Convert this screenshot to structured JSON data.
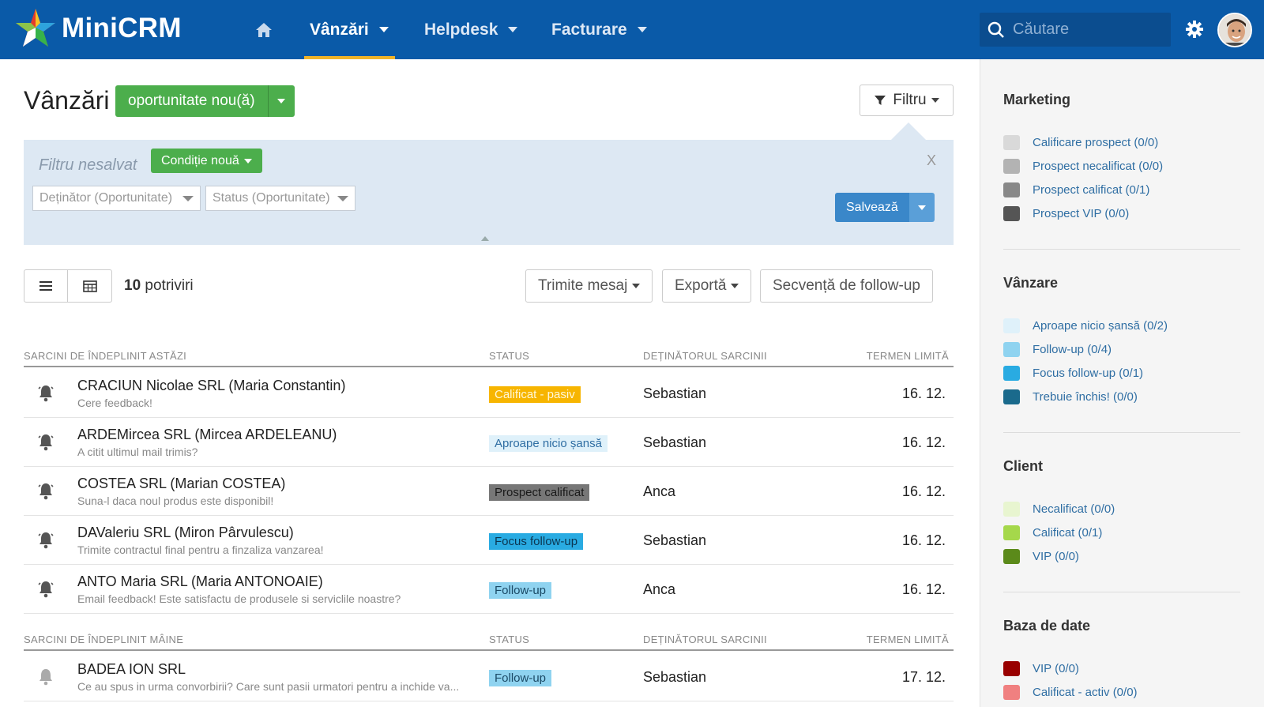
{
  "app": {
    "name": "MiniCRM"
  },
  "nav": {
    "items": [
      {
        "label": "Vânzări"
      },
      {
        "label": "Helpdesk"
      },
      {
        "label": "Facturare"
      }
    ],
    "search_placeholder": "Căutare"
  },
  "page": {
    "title": "Vânzări",
    "new_button": "oportunitate nou(ă)",
    "filter_button": "Filtru"
  },
  "filter": {
    "unsaved_label": "Filtru nesalvat",
    "new_condition": "Condiție nouă",
    "close": "X",
    "owner_select": "Deținător (Oportunitate)",
    "status_select": "Status (Oportunitate)",
    "save_button": "Salvează"
  },
  "toolbar": {
    "count": "10",
    "count_label": "potriviri",
    "send_message": "Trimite mesaj",
    "export": "Exportă",
    "followup_sequence": "Secvență de follow-up"
  },
  "columns": {
    "status": "STATUS",
    "owner": "DEȚINĂTORUL SARCINII",
    "due": "TERMEN LIMITĂ"
  },
  "today": {
    "heading": "SARCINI DE ÎNDEPLINIT ASTĂZI",
    "rows": [
      {
        "title": "CRACIUN Nicolae SRL (Maria Constantin)",
        "subtitle": "Cere feedback!",
        "status": "Calificat - pasiv",
        "owner": "Sebastian",
        "due": "16. 12."
      },
      {
        "title": "ARDEMircea SRL (Mircea ARDELEANU)",
        "subtitle": "A citit ultimul mail trimis?",
        "status": "Aproape nicio șansă",
        "owner": "Sebastian",
        "due": "16. 12."
      },
      {
        "title": "COSTEA SRL (Marian COSTEA)",
        "subtitle": "Suna-l daca noul produs este disponibil!",
        "status": "Prospect calificat",
        "owner": "Anca",
        "due": "16. 12."
      },
      {
        "title": "DAValeriu SRL (Miron Pârvulescu)",
        "subtitle": "Trimite contractul final pentru a finzaliza vanzarea!",
        "status": "Focus follow-up",
        "owner": "Sebastian",
        "due": "16. 12."
      },
      {
        "title": "ANTO Maria SRL (Maria ANTONOAIE)",
        "subtitle": "Email feedback! Este satisfactu de produsele si serviclile noastre?",
        "status": "Follow-up",
        "owner": "Anca",
        "due": "16. 12."
      }
    ]
  },
  "tomorrow": {
    "heading": "SARCINI DE ÎNDEPLINIT MÂINE",
    "rows": [
      {
        "title": "BADEA ION SRL",
        "subtitle": "Ce au spus in urma convorbirii? Care sunt pasii urmatori pentru a inchide va...",
        "status": "Follow-up",
        "owner": "Sebastian",
        "due": "17. 12."
      }
    ]
  },
  "sidebar": {
    "marketing": {
      "title": "Marketing",
      "items": [
        {
          "label": "Calificare prospect (0/0)",
          "color": "#d9d9d9"
        },
        {
          "label": "Prospect necalificat (0/0)",
          "color": "#b3b3b3"
        },
        {
          "label": "Prospect calificat (0/1)",
          "color": "#888888"
        },
        {
          "label": "Prospect VIP (0/0)",
          "color": "#555555"
        }
      ]
    },
    "vanzare": {
      "title": "Vânzare",
      "items": [
        {
          "label": "Aproape nicio șansă (0/2)",
          "color": "#dff1fa"
        },
        {
          "label": "Follow-up (0/4)",
          "color": "#8fd3f0"
        },
        {
          "label": "Focus follow-up (0/1)",
          "color": "#29abe2"
        },
        {
          "label": "Trebuie închis! (0/0)",
          "color": "#1a6a8c"
        }
      ]
    },
    "client": {
      "title": "Client",
      "items": [
        {
          "label": "Necalificat (0/0)",
          "color": "#e8f5d0"
        },
        {
          "label": "Calificat (0/1)",
          "color": "#a5d84b"
        },
        {
          "label": "VIP (0/0)",
          "color": "#5b8a1a"
        }
      ]
    },
    "database": {
      "title": "Baza de date",
      "items": [
        {
          "label": "VIP (0/0)",
          "color": "#990000"
        },
        {
          "label": "Calificat - activ (0/0)",
          "color": "#f08080"
        }
      ]
    }
  },
  "colors": {
    "nav_bg": "#0a5aa8",
    "accent": "#f0b429",
    "green": "#4cae4c",
    "save_blue": "#3a87c9"
  },
  "icons": [
    "home-icon",
    "search-icon",
    "gear-icon",
    "filter-icon",
    "list-view-icon",
    "table-view-icon",
    "bell-icon"
  ]
}
